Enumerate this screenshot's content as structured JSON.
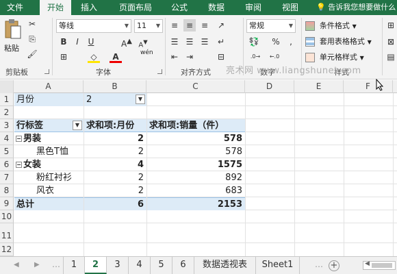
{
  "ribbon_tabs": [
    "文件",
    "开始",
    "插入",
    "页面布局",
    "公式",
    "数据",
    "审阅",
    "视图"
  ],
  "tell_me": "告诉我您想要做什么",
  "clipboard": {
    "paste": "粘贴",
    "label": "剪贴板"
  },
  "font": {
    "name": "等线",
    "size": "11",
    "label": "字体",
    "wen": "wén"
  },
  "alignment": {
    "label": "对齐方式"
  },
  "number": {
    "format": "常规",
    "label": "数字"
  },
  "styles": {
    "conditional": "条件格式",
    "table": "套用表格格式",
    "cell": "单元格样式",
    "label": "样式"
  },
  "watermark": "亮术网 www.liangshunet.com",
  "columns": [
    "A",
    "B",
    "C",
    "D",
    "E",
    "F"
  ],
  "rows": [
    "1",
    "2",
    "3",
    "4",
    "5",
    "6",
    "7",
    "8",
    "9",
    "10",
    "11",
    "12"
  ],
  "pivot": {
    "filter_label": "月份",
    "filter_value": "2",
    "header_row_label": "行标签",
    "header_sum_month": "求和项:月份",
    "header_sum_qty": "求和项:销量（件）",
    "r4": {
      "label": "男装",
      "b": "2",
      "c": "578"
    },
    "r5": {
      "label": "黑色T恤",
      "b": "2",
      "c": "578"
    },
    "r6": {
      "label": "女装",
      "b": "4",
      "c": "1575"
    },
    "r7": {
      "label": "粉红衬衫",
      "b": "2",
      "c": "892"
    },
    "r8": {
      "label": "风衣",
      "b": "2",
      "c": "683"
    },
    "r9": {
      "label": "总计",
      "b": "6",
      "c": "2153"
    }
  },
  "sheet_tabs": [
    "1",
    "2",
    "3",
    "4",
    "5",
    "6",
    "数据透视表",
    "Sheet1"
  ],
  "active_sheet": "2",
  "colors": {
    "excel_green": "#217346",
    "pivot_blue": "#ddebf7"
  }
}
